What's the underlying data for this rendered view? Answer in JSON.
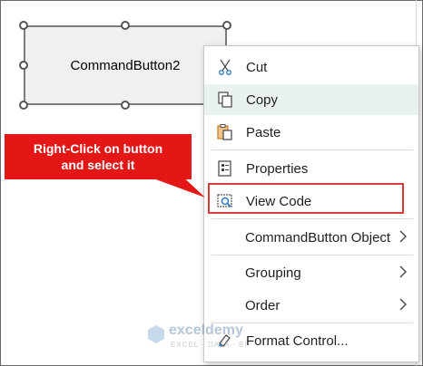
{
  "command_button": {
    "label": "CommandButton2"
  },
  "callout": {
    "line1": "Right-Click on button",
    "line2": "and select it"
  },
  "context_menu": {
    "items": [
      {
        "label": "Cut",
        "icon": "scissors-icon"
      },
      {
        "label": "Copy",
        "icon": "copy-icon"
      },
      {
        "label": "Paste",
        "icon": "clipboard-icon"
      },
      {
        "label": "Properties",
        "icon": "properties-icon"
      },
      {
        "label": "View Code",
        "icon": "view-code-icon"
      },
      {
        "label": "CommandButton Object",
        "has_submenu": true
      },
      {
        "label": "Grouping",
        "has_submenu": true
      },
      {
        "label": "Order",
        "has_submenu": true
      },
      {
        "label": "Format Control...",
        "icon": "format-control-icon"
      }
    ]
  },
  "watermark": {
    "brand": "exceldemy",
    "tagline": "EXCEL · DATA · BI"
  },
  "colors": {
    "callout_red": "#e41616",
    "highlight_border": "#d8393a",
    "hover_bg": "#e9f2ed"
  }
}
